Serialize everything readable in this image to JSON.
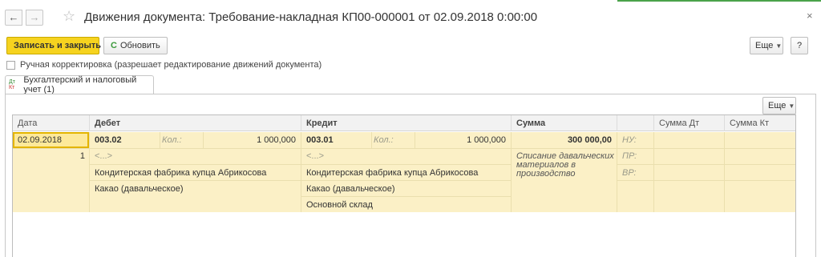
{
  "window": {
    "title": "Движения документа: Требование-накладная КП00-000001 от 02.09.2018 0:00:00",
    "back_icon": "arrow-left-icon",
    "forward_icon": "arrow-right-icon",
    "favorite_icon": "star-icon",
    "close_label": "×"
  },
  "toolbar": {
    "save_close_label": "Записать и закрыть",
    "refresh_label": "Обновить",
    "refresh_glyph": "C",
    "more_label": "Еще",
    "help_label": "?"
  },
  "manual_correction": {
    "checked": false,
    "label": "Ручная корректировка (разрешает редактирование движений документа)"
  },
  "tabs": [
    {
      "label": "Бухгалтерский и налоговый учет (1)",
      "icon_top": "Дт",
      "icon_bottom": "Кт"
    }
  ],
  "table": {
    "more_label": "Еще",
    "headers": {
      "date": "Дата",
      "debit": "Дебет",
      "credit": "Кредит",
      "sum": "Сумма",
      "sum_dt": "Сумма Дт",
      "sum_kt": "Сумма Кт"
    },
    "rows": [
      {
        "date": "02.09.2018",
        "number": "1",
        "debit": {
          "account": "003.02",
          "qty_label": "Кол.:",
          "qty": "1 000,000",
          "subconto_empty": "<...>",
          "subconto1": "Кондитерская фабрика купца Абрикосова",
          "subconto2": "Какао (давальческое)"
        },
        "credit": {
          "account": "003.01",
          "qty_label": "Кол.:",
          "qty": "1 000,000",
          "subconto_empty": "<...>",
          "subconto1": "Кондитерская фабрика купца Абрикосова",
          "subconto2": "Какао (давальческое)",
          "subconto3": "Основной склад"
        },
        "sum": "300 000,00",
        "content": "Списание давальческих материалов в производство",
        "nu_label": "НУ:",
        "pr_label": "ПР:",
        "vr_label": "ВР:"
      }
    ]
  },
  "colors": {
    "primary_button": "#f6d31f",
    "row_highlight": "#fbf0c6",
    "selected_cell": "#fde99a"
  }
}
